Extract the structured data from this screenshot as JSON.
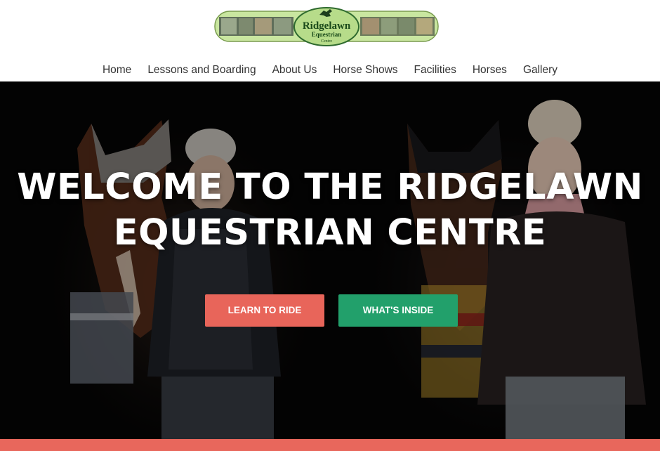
{
  "logo": {
    "text_line1": "Ridgelawn",
    "text_line2": "Equestrian",
    "text_line3": "Centre"
  },
  "nav": {
    "items": [
      {
        "label": "Home"
      },
      {
        "label": "Lessons and Boarding"
      },
      {
        "label": "About Us"
      },
      {
        "label": "Horse Shows"
      },
      {
        "label": "Facilities"
      },
      {
        "label": "Horses"
      },
      {
        "label": "Gallery"
      }
    ]
  },
  "hero": {
    "title_line1": "WELCOME TO THE RIDGELAWN",
    "title_line2": "EQUESTRIAN CENTRE",
    "buttons": {
      "learn_label": "LEARN TO RIDE",
      "inside_label": "WHAT'S INSIDE"
    }
  },
  "colors": {
    "learn_button": "#e8655a",
    "inside_button": "#22a06b",
    "bottom_band": "#e8675c",
    "logo_green": "#b7dc8a",
    "hero_background": "#050505"
  }
}
